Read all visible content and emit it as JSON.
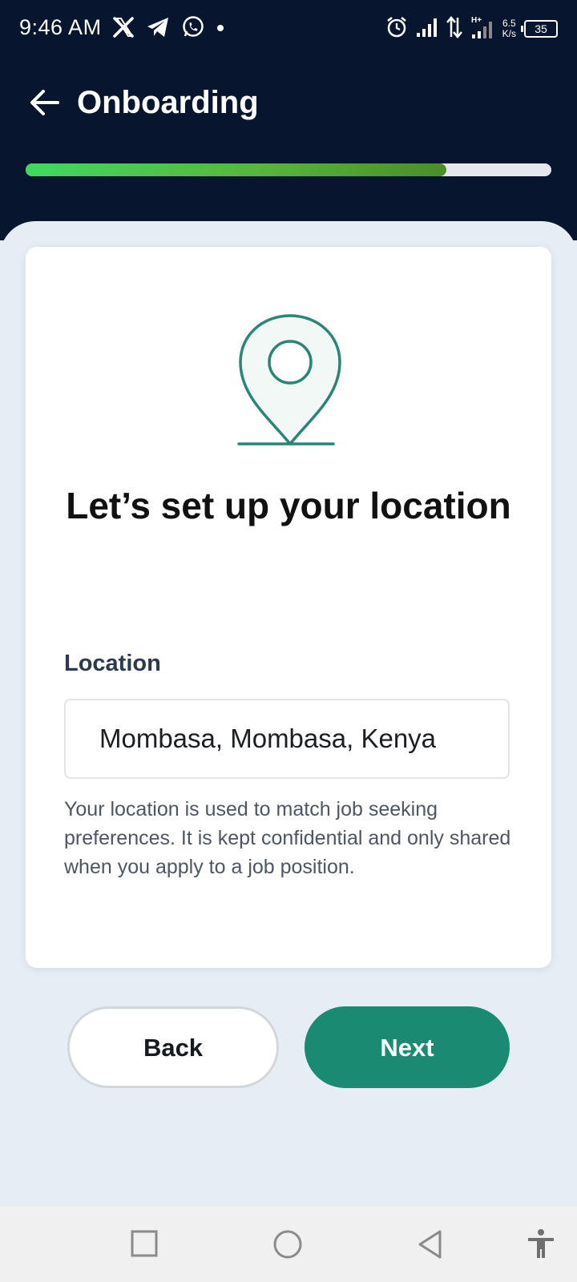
{
  "status_bar": {
    "time": "9:46 AM",
    "network_speed_value": "6.5",
    "network_speed_unit": "K/s",
    "battery": "35",
    "icons": [
      "x-icon",
      "telegram-icon",
      "whatsapp-icon",
      "dot-icon",
      "alarm-icon",
      "signal-icon",
      "data-arrows-icon",
      "signal-hplus-icon"
    ]
  },
  "header": {
    "title": "Onboarding",
    "back_icon": "arrow-left-icon"
  },
  "progress": {
    "fraction": 0.8,
    "color_start": "#3fd95f",
    "color_end": "#4a8e28"
  },
  "card": {
    "icon": "location-pin-icon",
    "heading": "Let’s set up your location",
    "field_label": "Location",
    "location_value": "Mombasa, Mombasa, Kenya",
    "helper_text": "Your location is used to match job seeking preferences. It is kept confidential and only shared when you apply to a job position."
  },
  "actions": {
    "back_label": "Back",
    "next_label": "Next",
    "accent_color": "#1b8a72"
  },
  "nav_bar": {
    "icons": [
      "recents-square-icon",
      "home-circle-icon",
      "back-triangle-icon",
      "accessibility-icon"
    ]
  }
}
